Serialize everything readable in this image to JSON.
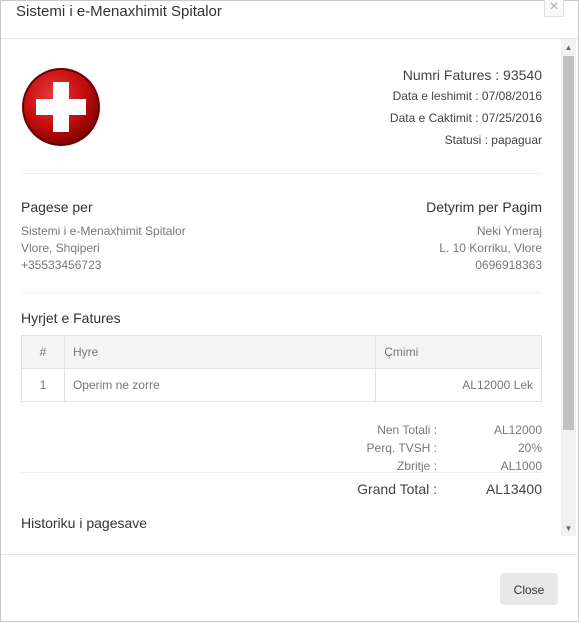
{
  "modal": {
    "title": "Sistemi i e-Menaxhimit Spitalor",
    "close_x": "×"
  },
  "invoice": {
    "number": "Numri Fatures : 93540",
    "issue_date": "Data e leshimit : 07/08/2016",
    "due_date": "Data e Caktimit : 07/25/2016",
    "status": "Statusi : papaguar"
  },
  "payment_to": {
    "title": "Pagese per",
    "lines": [
      "Sistemi i e-Menaxhimit Spitalor",
      "Vlore, Shqiperi",
      "+35533456723"
    ]
  },
  "bill_to": {
    "title": "Detyrim per Pagim",
    "lines": [
      "Neki Ymeraj",
      "L. 10 Korriku, Vlore",
      "0696918363"
    ]
  },
  "items_section": {
    "title": "Hyrjet e Fatures",
    "columns": [
      "#",
      "Hyre",
      "Çmimi"
    ],
    "rows": [
      {
        "num": "1",
        "item": "Operim ne zorre",
        "price": "AL12000 Lek"
      }
    ]
  },
  "totals": {
    "subtotal_label": "Nen Totali :",
    "subtotal_value": "AL12000",
    "vat_label": "Perq. TVSH :",
    "vat_value": "20%",
    "discount_label": "Zbritje :",
    "discount_value": "AL1000",
    "grand_label": "Grand Total :",
    "grand_value": "AL13400"
  },
  "history": {
    "title": "Historiku i pagesave"
  },
  "footer": {
    "close_label": "Close"
  },
  "icons": {
    "logo": "red-cross-icon",
    "scroll_up": "arrow-up-icon",
    "scroll_down": "arrow-down-icon"
  },
  "colors": {
    "logo_red": "#cc0000",
    "button_bg": "#e8e8e8"
  }
}
